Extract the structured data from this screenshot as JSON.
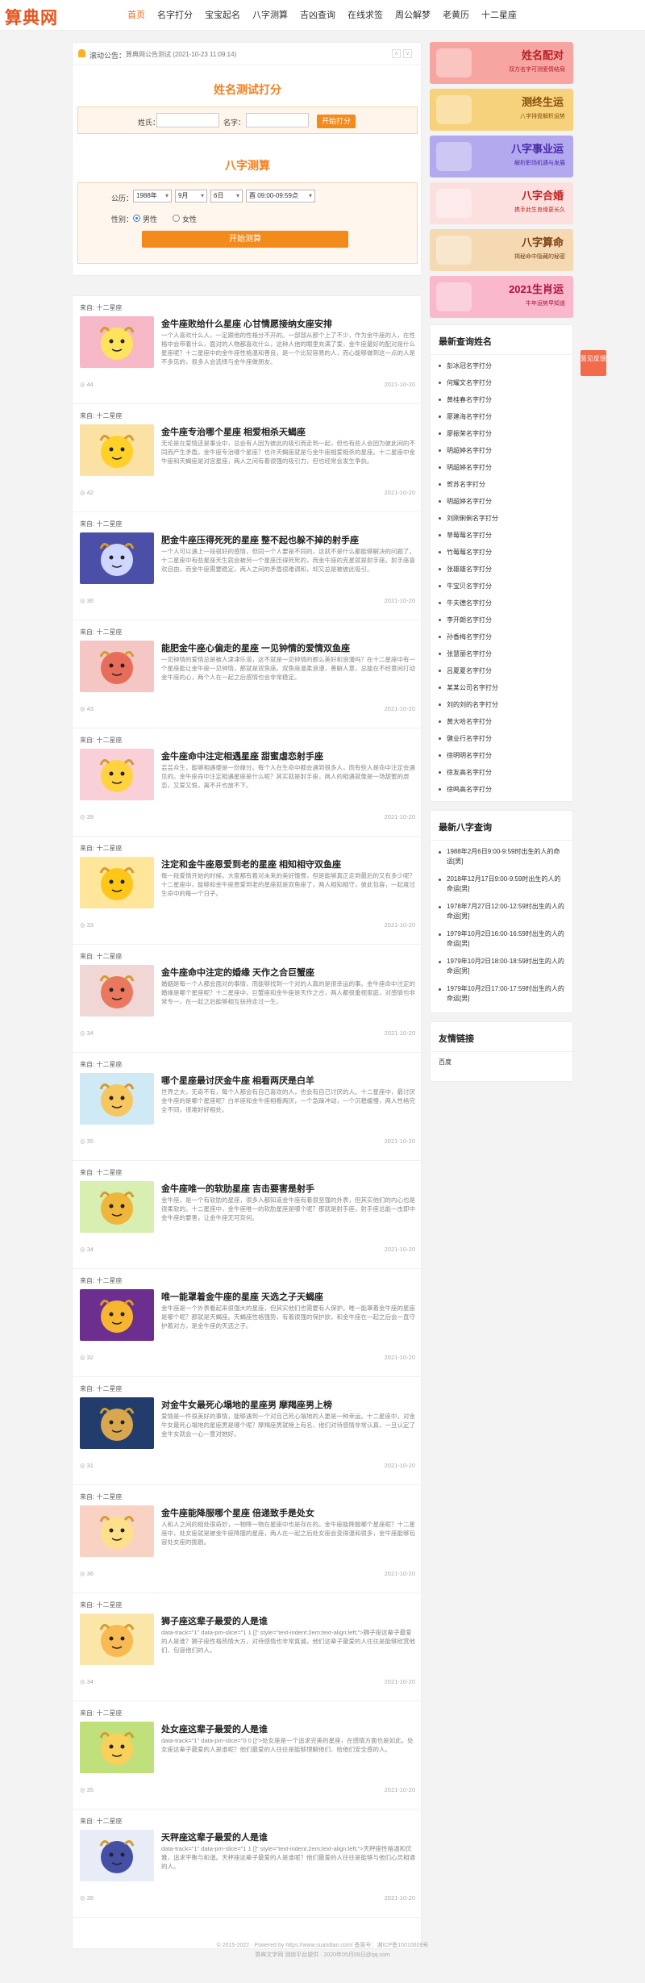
{
  "site": {
    "logo": "算典网"
  },
  "nav": {
    "items": [
      "首页",
      "名字打分",
      "宝宝起名",
      "八字测算",
      "吉凶查询",
      "在线求签",
      "周公解梦",
      "老黄历",
      "十二星座"
    ]
  },
  "notice": {
    "label": "滚动公告：",
    "text": "算典网公告测试 (2021-10-23 11:09:14)",
    "prev": "∧",
    "next": "∨"
  },
  "name_test": {
    "title": "姓名测试打分",
    "surname_label": "姓氏：",
    "name_label": "名字：",
    "button": "开始打分"
  },
  "bazi": {
    "title": "八字测算",
    "birth_label": "公历：",
    "year": "1988年",
    "month": "9月",
    "day": "6日",
    "hour": "酉 09:00-09:59点",
    "gender_label": "性别：",
    "male": "男性",
    "female": "女性",
    "button": "开始测算"
  },
  "articles": [
    {
      "source": "来自: 十二星座",
      "title": "金牛座败给什么星座 心甘情愿接纳女座安排",
      "desc": "一个人喜欢什么人，一定跟他的性格分不开的。一部部从那个上了不少，作为金牛座的人，在性格中会带着什么，面对的人物都喜欢什么，这种人他的眼里充满了爱，金牛座最好的配对是什么星座呢？十二星座中的金牛座性格温和善良，是一个比较容易的人，而心能够做到这一点的人是不多见的，很多人会选择与金牛座做朋友。",
      "views": "44",
      "date": "2021-10-20"
    },
    {
      "source": "来自: 十二星座",
      "title": "金牛座专治哪个星座 相爱相杀天蝎座",
      "desc": "无论是在爱情还是事业中，总会有人因为彼此的吸引而走到一起，但也有些人会因为彼此间的不同而产生矛盾。金牛座专治哪个星座？也许天蝎座就是与金牛座相爱相杀的星座。十二星座中金牛座和天蝎座是对宫星座，两人之间有着很强的吸引力，但也经常会发生争执。",
      "views": "42",
      "date": "2021-10-20"
    },
    {
      "source": "来自: 十二星座",
      "title": "肥金牛座压得死死的星座 整不起也躲不掉的射手座",
      "desc": "一个人可以遇上一段很好的感情，但同一个人要是不同的，这就不是什么都能够解决的问题了。十二星座中有些星座天生就会被另一个星座压得死死的，而金牛座的克星就是射手座。射手座喜欢自由，而金牛座需要稳定，两人之间的矛盾很难调和，却又总是被彼此吸引。",
      "views": "36",
      "date": "2021-10-20"
    },
    {
      "source": "来自: 十二星座",
      "title": "能肥金牛座心偏走的星座 一见钟情的爱情双鱼座",
      "desc": "一见钟情的爱情总是被人津津乐道，这不就是一见钟情的那么美好和浪漫吗？在十二星座中有一个星座能让金牛座一见钟情，那就是双鱼座。双鱼座温柔浪漫，善解人意，总能在不经意间打动金牛座的心，两个人在一起之后感情也会非常稳定。",
      "views": "43",
      "date": "2021-10-20"
    },
    {
      "source": "来自: 十二星座",
      "title": "金牛座命中注定相遇星座 甜蜜虐恋射手座",
      "desc": "芸芸众生，能够相遇便是一份缘分。每个人在生命中都会遇到很多人，而有些人是命中注定会遇见的。金牛座命中注定相遇星座是什么呢？其实就是射手座，两人的相遇就像是一场甜蜜的虐恋，又爱又恨，离不开也放不下。",
      "views": "39",
      "date": "2021-10-20"
    },
    {
      "source": "来自: 十二星座",
      "title": "注定和金牛座恩爱到老的星座 相知相守双鱼座",
      "desc": "每一段爱情开始的时候，大家都有着对未来的美好憧憬，但是能够真正走到最后的又有多少呢？十二星座中，能够和金牛座恩爱到老的星座就是双鱼座了，两人相知相守，彼此包容，一起度过生命中的每一个日子。",
      "views": "33",
      "date": "2021-10-20"
    },
    {
      "source": "来自: 十二星座",
      "title": "金牛座命中注定的婚缘 天作之合巨蟹座",
      "desc": "婚姻是每一个人都会面对的事情，而能够找到一个对的人真的是很幸运的事。金牛座命中注定的婚缘是哪个星座呢？十二星座中，巨蟹座和金牛座是天作之合，两人都很重视家庭，对感情也非常专一，在一起之后能够相互扶持走过一生。",
      "views": "34",
      "date": "2021-10-20"
    },
    {
      "source": "来自: 十二星座",
      "title": "哪个星座最讨厌金牛座 相看两厌是白羊",
      "desc": "世界之大，无奇不有，每个人都会有自己喜欢的人，也会有自己讨厌的人。十二星座中，最讨厌金牛座的是哪个星座呢？白羊座和金牛座相看两厌，一个急躁冲动，一个沉稳缓慢，两人性格完全不同，很难好好相处。",
      "views": "35",
      "date": "2021-10-20"
    },
    {
      "source": "来自: 十二星座",
      "title": "金牛座唯一的软肋星座 吉击要害是射手",
      "desc": "金牛座，是一个有软肋的星座，很多人都知道金牛座有着很坚强的外表，但其实他们的内心也是很柔软的。十二星座中，金牛座唯一的软肋星座是哪个呢？那就是射手座，射手座总能一击即中金牛座的要害，让金牛座无可奈何。",
      "views": "34",
      "date": "2021-10-20"
    },
    {
      "source": "来自: 十二星座",
      "title": "唯一能罩着金牛座的星座 天选之子天蝎座",
      "desc": "金牛座是一个外表看起来很强大的星座，但其实他们也需要有人保护。唯一能罩着金牛座的星座是哪个呢？那就是天蝎座。天蝎座性格强势，有着很强的保护欲，和金牛座在一起之后会一直守护着对方，是金牛座的天选之子。",
      "views": "32",
      "date": "2021-10-20"
    },
    {
      "source": "来自: 十二星座",
      "title": "对金牛女最死心塌地的星座男 摩羯座男上榜",
      "desc": "爱情是一件很美好的事情，能够遇到一个对自己死心塌地的人更是一种幸运。十二星座中，对金牛女最死心塌地的星座男是哪个呢？摩羯座男就榜上有名，他们对待感情非常认真，一旦认定了金牛女就会一心一意对她好。",
      "views": "31",
      "date": "2021-10-20"
    },
    {
      "source": "来自: 十二星座",
      "title": "金牛座能降服哪个星座 倍递致手是处女",
      "desc": "人和人之间的相处很奇妙，一物降一物在星座中也是存在的。金牛座能降服哪个星座呢？十二星座中，处女座就是被金牛座降服的星座，两人在一起之后处女座会变得温和很多，金牛座能够包容处女座的挑剔。",
      "views": "36",
      "date": "2021-10-20"
    },
    {
      "source": "来自: 十二星座",
      "title": "狮子座这辈子最爱的人是谁",
      "desc": "data-track=\"1\" data-pm-slice=\"1 1 []\" style=\"text-indent:2em;text-align:left;\">狮子座这辈子最爱的人是谁？狮子座性格热情大方，对待感情也非常真诚，他们这辈子最爱的人往往是能够欣赏他们、包容他们的人。",
      "views": "34",
      "date": "2021-10-20"
    },
    {
      "source": "来自: 十二星座",
      "title": "处女座这辈子最爱的人是谁",
      "desc": "data-track=\"1\" data-pm-slice=\"0 0 []\">处女座是一个追求完美的星座，在感情方面也是如此。处女座这辈子最爱的人是谁呢？他们最爱的人往往是能够理解他们、给他们安全感的人。",
      "views": "35",
      "date": "2021-10-20"
    },
    {
      "source": "来自: 十二星座",
      "title": "天秤座这辈子最爱的人是谁",
      "desc": "data-track=\"1\" data-pm-slice=\"1 1 []\" style=\"text-indent:2em;text-align:left;\">天秤座性格温和优雅，追求平衡与和谐。天秤座这辈子最爱的人是谁呢？他们最爱的人往往是能够与他们心灵相通的人。",
      "views": "38",
      "date": "2021-10-20"
    }
  ],
  "banners": [
    {
      "title": "姓名配对",
      "sub": "双方名字可测爱情结局",
      "color": "#f7a5a0",
      "text": "#b8202a"
    },
    {
      "title": "测终生运",
      "sub": "八字排盘解析运势",
      "color": "#f6d27c",
      "text": "#8a4d0c"
    },
    {
      "title": "八字事业运",
      "sub": "解析职场机遇与发展",
      "color": "#b3a9ef",
      "text": "#4a2aa8"
    },
    {
      "title": "八字合婚",
      "sub": "携手此生良缘更长久",
      "color": "#fbe0df",
      "text": "#c21f1f"
    },
    {
      "title": "八字算命",
      "sub": "揭秘命中隐藏的秘密",
      "color": "#f4d9b2",
      "text": "#7a3f10"
    },
    {
      "title": "2021生肖运",
      "sub": "牛年运势早知道",
      "color": "#f9b8cb",
      "text": "#b0123f"
    }
  ],
  "recent_names": {
    "title": "最新查询姓名",
    "items": [
      "彭冰冠名字打分",
      "何耀文名字打分",
      "黄桂春名字打分",
      "廖建海名字打分",
      "廖振荣名字打分",
      "明超婷名字打分",
      "明超婷名字打分",
      "贺苏名字打分",
      "明超婷名字打分",
      "刘刚俐俐名字打分",
      "草莓莓名字打分",
      "竹莓莓名字打分",
      "张雄雄名字打分",
      "牛宝贝名字打分",
      "牛夫德名字打分",
      "李开朗名字打分",
      "孙香梅名字打分",
      "张慧丽名字打分",
      "吕夏夏名字打分",
      "某某公司名字打分",
      "刘的刘的名字打分",
      "黄大哈名字打分",
      "健业行名字打分",
      "徐明明名字打分",
      "徐友高名字打分",
      "徐鸣高名字打分"
    ]
  },
  "recent_bazi": {
    "title": "最新八字查询",
    "items": [
      "1988年2月6日9:00-9:59时出生的人的命运[男]",
      "2018年12月17日9:00-9:59时出生的人的命运[男]",
      "1978年7月27日12:00-12:59时出生的人的命运[男]",
      "1979年10月2日16:00-16:59时出生的人的命运[男]",
      "1979年10月2日18:00-18:59时出生的人的命运[男]",
      "1979年10月2日17:00-17:59时出生的人的命运[男]"
    ]
  },
  "friend_links": {
    "title": "友情链接",
    "items": [
      "百度"
    ]
  },
  "float_btn": {
    "label": "意见反馈"
  },
  "footer": {
    "line1": "© 2015-2022 · Powered by https://www.suandian.com/ 备案号：湘ICP备15010609号",
    "line2": "算典文字网 测综平台提供 · 2020年05月09日@qq.com"
  }
}
